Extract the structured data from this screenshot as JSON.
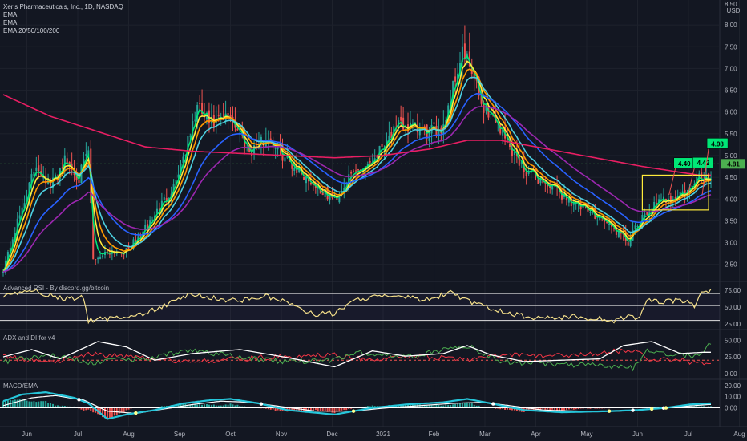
{
  "header": {
    "title": "Xeris Pharmaceuticals, Inc., 1D, NASDAQ",
    "indicators": [
      "EMA",
      "EMA",
      "EMA 20/50/100/200"
    ],
    "currency": "USD"
  },
  "panels": {
    "rsi_title": "Advanced RSI - By discord.gg/bitcoin",
    "adx_title": "ADX and DI for v4",
    "macd_title": "MACD/EMA"
  },
  "colors": {
    "background": "#131722",
    "grid": "#1e222d",
    "up": "#26a69a",
    "down": "#ef5350",
    "ema_green": "#00e676",
    "ema_yellow": "#ffeb3b",
    "ema_orange": "#ff9800",
    "ema_cyan": "#4dd0e1",
    "ema_blue": "#2962ff",
    "ema_purple": "#9c27b0",
    "ema_red": "#e91e63",
    "current_price": "#4caf50",
    "rsi_line": "#f5e08a",
    "adx_white": "#ffffff",
    "adx_red": "#f23645",
    "adx_green": "#4caf50",
    "macd_line": "#26c6da",
    "signal_line": "#ffffff"
  },
  "chart_data": {
    "type": "candlestick",
    "x_ticks": [
      "Jun",
      "Jul",
      "Aug",
      "Sep",
      "Oct",
      "Nov",
      "Dec",
      "2021",
      "Feb",
      "Mar",
      "Apr",
      "May",
      "Jun",
      "Jul",
      "Aug"
    ],
    "price_axis": {
      "ticks": [
        2.5,
        3.0,
        3.5,
        4.0,
        4.5,
        5.0,
        5.5,
        6.0,
        6.5,
        7.0,
        7.5,
        8.0
      ],
      "ylim": [
        2.2,
        8.5
      ],
      "top_label": "8.50",
      "current_price": 4.81,
      "current_price_label": "4.81"
    },
    "close_keypoints": [
      [
        0,
        2.4
      ],
      [
        8,
        3.8
      ],
      [
        14,
        4.8
      ],
      [
        20,
        4.3
      ],
      [
        26,
        4.9
      ],
      [
        32,
        4.5
      ],
      [
        36,
        5.1
      ],
      [
        38,
        2.6
      ],
      [
        44,
        2.8
      ],
      [
        52,
        2.8
      ],
      [
        60,
        3.3
      ],
      [
        66,
        3.8
      ],
      [
        72,
        4.3
      ],
      [
        78,
        5.3
      ],
      [
        82,
        6.1
      ],
      [
        88,
        5.7
      ],
      [
        96,
        5.9
      ],
      [
        104,
        5.1
      ],
      [
        112,
        5.4
      ],
      [
        120,
        4.9
      ],
      [
        128,
        4.5
      ],
      [
        136,
        4.1
      ],
      [
        140,
        4.0
      ],
      [
        148,
        4.6
      ],
      [
        156,
        4.9
      ],
      [
        162,
        5.4
      ],
      [
        168,
        5.7
      ],
      [
        174,
        5.6
      ],
      [
        180,
        5.5
      ],
      [
        186,
        5.7
      ],
      [
        190,
        6.6
      ],
      [
        194,
        7.4
      ],
      [
        198,
        6.9
      ],
      [
        202,
        6.2
      ],
      [
        208,
        5.8
      ],
      [
        214,
        5.2
      ],
      [
        220,
        4.7
      ],
      [
        228,
        4.4
      ],
      [
        236,
        4.1
      ],
      [
        244,
        3.8
      ],
      [
        252,
        3.6
      ],
      [
        258,
        3.3
      ],
      [
        264,
        3.0
      ],
      [
        268,
        3.4
      ],
      [
        274,
        3.8
      ],
      [
        280,
        4.0
      ],
      [
        286,
        4.1
      ],
      [
        290,
        4.2
      ],
      [
        294,
        4.5
      ]
    ],
    "ema200_keypoints": [
      [
        0,
        6.4
      ],
      [
        20,
        5.9
      ],
      [
        40,
        5.55
      ],
      [
        60,
        5.2
      ],
      [
        80,
        5.1
      ],
      [
        100,
        5.05
      ],
      [
        120,
        5.0
      ],
      [
        140,
        4.95
      ],
      [
        160,
        5.0
      ],
      [
        180,
        5.15
      ],
      [
        196,
        5.35
      ],
      [
        210,
        5.35
      ],
      [
        230,
        5.15
      ],
      [
        250,
        4.95
      ],
      [
        270,
        4.75
      ],
      [
        294,
        4.55
      ]
    ],
    "price_tags": [
      {
        "label": "4.40",
        "index": 284,
        "value": 4.82
      },
      {
        "label": "4.42",
        "index": 292,
        "value": 4.83
      },
      {
        "label": "4.98",
        "index": 298,
        "value": 5.27
      }
    ],
    "highlight_box": {
      "start_index": 270,
      "end_index": 298,
      "y_low": 3.75,
      "y_high": 4.55
    },
    "rsi": {
      "ticks": [
        25.0,
        50.0,
        75.0
      ],
      "ylim": [
        20,
        82
      ],
      "bands": [
        30,
        52,
        70
      ],
      "keypoints": [
        [
          0,
          64
        ],
        [
          10,
          76
        ],
        [
          20,
          68
        ],
        [
          26,
          62
        ],
        [
          34,
          64
        ],
        [
          36,
          30
        ],
        [
          46,
          33
        ],
        [
          60,
          40
        ],
        [
          72,
          58
        ],
        [
          80,
          70
        ],
        [
          90,
          62
        ],
        [
          100,
          60
        ],
        [
          110,
          66
        ],
        [
          120,
          58
        ],
        [
          130,
          40
        ],
        [
          140,
          40
        ],
        [
          150,
          62
        ],
        [
          160,
          66
        ],
        [
          170,
          64
        ],
        [
          180,
          60
        ],
        [
          188,
          72
        ],
        [
          194,
          62
        ],
        [
          200,
          54
        ],
        [
          210,
          44
        ],
        [
          220,
          36
        ],
        [
          230,
          33
        ],
        [
          240,
          36
        ],
        [
          250,
          33
        ],
        [
          258,
          30
        ],
        [
          266,
          36
        ],
        [
          268,
          32
        ],
        [
          272,
          60
        ],
        [
          280,
          58
        ],
        [
          288,
          60
        ],
        [
          292,
          52
        ],
        [
          296,
          75
        ]
      ]
    },
    "adx": {
      "ticks": [
        0.0,
        25.0,
        50.0
      ],
      "ylim": [
        -5,
        60
      ],
      "adx_keypoints": [
        [
          0,
          25
        ],
        [
          12,
          36
        ],
        [
          24,
          22
        ],
        [
          40,
          48
        ],
        [
          52,
          40
        ],
        [
          64,
          20
        ],
        [
          80,
          30
        ],
        [
          100,
          36
        ],
        [
          120,
          24
        ],
        [
          140,
          10
        ],
        [
          156,
          34
        ],
        [
          170,
          26
        ],
        [
          186,
          30
        ],
        [
          196,
          42
        ],
        [
          206,
          28
        ],
        [
          220,
          18
        ],
        [
          236,
          20
        ],
        [
          252,
          22
        ],
        [
          262,
          42
        ],
        [
          274,
          48
        ],
        [
          286,
          30
        ],
        [
          296,
          32
        ]
      ],
      "di_plus_keypoints": [
        [
          0,
          18
        ],
        [
          20,
          28
        ],
        [
          36,
          16
        ],
        [
          48,
          20
        ],
        [
          64,
          24
        ],
        [
          80,
          36
        ],
        [
          100,
          24
        ],
        [
          120,
          18
        ],
        [
          140,
          20
        ],
        [
          150,
          32
        ],
        [
          170,
          24
        ],
        [
          186,
          36
        ],
        [
          196,
          42
        ],
        [
          210,
          18
        ],
        [
          230,
          14
        ],
        [
          250,
          12
        ],
        [
          266,
          8
        ],
        [
          272,
          34
        ],
        [
          286,
          28
        ],
        [
          294,
          26
        ],
        [
          298,
          46
        ]
      ],
      "di_minus_keypoints": [
        [
          0,
          26
        ],
        [
          20,
          16
        ],
        [
          36,
          30
        ],
        [
          52,
          26
        ],
        [
          66,
          20
        ],
        [
          80,
          18
        ],
        [
          100,
          22
        ],
        [
          120,
          26
        ],
        [
          140,
          28
        ],
        [
          156,
          20
        ],
        [
          176,
          26
        ],
        [
          196,
          20
        ],
        [
          210,
          28
        ],
        [
          230,
          26
        ],
        [
          250,
          30
        ],
        [
          266,
          36
        ],
        [
          272,
          22
        ],
        [
          286,
          20
        ],
        [
          296,
          14
        ]
      ],
      "ref_level": 20
    },
    "macd": {
      "ticks": [
        0.0,
        10.0,
        20.0
      ],
      "ylim": [
        -14,
        22
      ],
      "macd_keypoints": [
        [
          0,
          6
        ],
        [
          8,
          12
        ],
        [
          18,
          14
        ],
        [
          30,
          9
        ],
        [
          36,
          4
        ],
        [
          44,
          -10
        ],
        [
          52,
          -6
        ],
        [
          64,
          -2
        ],
        [
          76,
          4
        ],
        [
          88,
          7
        ],
        [
          96,
          8
        ],
        [
          108,
          4
        ],
        [
          120,
          -2
        ],
        [
          140,
          -6
        ],
        [
          156,
          0
        ],
        [
          170,
          3
        ],
        [
          186,
          5
        ],
        [
          196,
          8
        ],
        [
          206,
          4
        ],
        [
          220,
          -2
        ],
        [
          236,
          -4
        ],
        [
          256,
          -3
        ],
        [
          268,
          -2
        ],
        [
          280,
          0
        ],
        [
          290,
          3
        ],
        [
          298,
          4
        ]
      ],
      "signal_keypoints": [
        [
          0,
          2
        ],
        [
          12,
          9
        ],
        [
          22,
          11
        ],
        [
          34,
          7
        ],
        [
          44,
          -3
        ],
        [
          56,
          -5
        ],
        [
          68,
          -1
        ],
        [
          80,
          3
        ],
        [
          92,
          6
        ],
        [
          104,
          5
        ],
        [
          118,
          1
        ],
        [
          132,
          -3
        ],
        [
          148,
          -3
        ],
        [
          162,
          0
        ],
        [
          176,
          2
        ],
        [
          190,
          4
        ],
        [
          202,
          5
        ],
        [
          214,
          2
        ],
        [
          228,
          -2
        ],
        [
          244,
          -3
        ],
        [
          260,
          -3
        ],
        [
          274,
          -1
        ],
        [
          286,
          1
        ],
        [
          298,
          3
        ]
      ]
    }
  }
}
